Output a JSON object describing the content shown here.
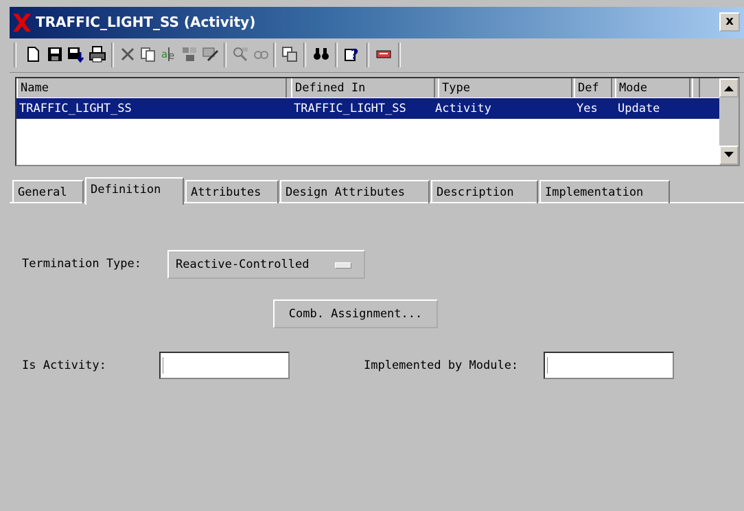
{
  "window": {
    "title": "TRAFFIC_LIGHT_SS (Activity)",
    "close_label": "x"
  },
  "toolbar": {
    "buttons": [
      "new-doc-icon",
      "save-icon",
      "save-down-icon",
      "print-icon",
      "delete-icon",
      "copy-icon",
      "attributes-icon",
      "merge-icon",
      "edit-icon",
      "search-icon",
      "find-icon",
      "properties-icon",
      "binoculars-icon",
      "help-icon",
      "highlight-icon"
    ]
  },
  "list": {
    "headers": [
      "Name",
      "Defined In",
      "Type",
      "Def",
      "Mode"
    ],
    "rows": [
      {
        "name": "TRAFFIC_LIGHT_SS",
        "defined_in": "TRAFFIC_LIGHT_SS",
        "type": "Activity",
        "def": "Yes",
        "mode": "Update"
      }
    ]
  },
  "tabs": [
    "General",
    "Definition",
    "Attributes",
    "Design Attributes",
    "Description",
    "Implementation"
  ],
  "active_tab": "Definition",
  "definition": {
    "termination_label": "Termination Type:",
    "termination_value": "Reactive-Controlled",
    "comb_button": "Comb. Assignment...",
    "is_activity_label": "Is Activity:",
    "is_activity_value": "",
    "implemented_label": "Implemented by Module:",
    "implemented_value": ""
  },
  "colors": {
    "selection": "#0b1f80",
    "panel": "#c0c0c0",
    "title_gradient_start": "#0a246a"
  }
}
